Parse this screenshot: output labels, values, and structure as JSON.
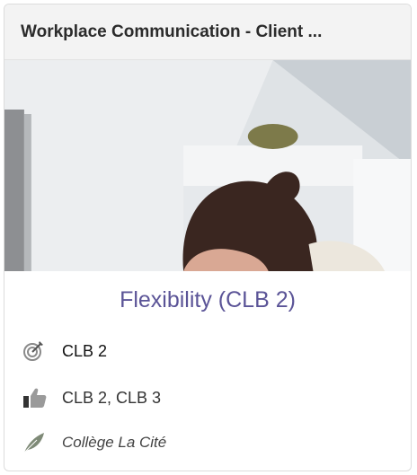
{
  "card": {
    "header_title": "Workplace Communication - Client ...",
    "course_title": "Flexibility (CLB 2)",
    "target_level": "CLB 2",
    "recommended_levels": "CLB 2, CLB 3",
    "provider": "Collège La Cité"
  },
  "icons": {
    "target": "target-icon",
    "thumbs_up": "thumbs-up-icon",
    "provider": "feather-icon"
  },
  "colors": {
    "title": "#5b5497",
    "header_bg": "#f3f3f3"
  }
}
